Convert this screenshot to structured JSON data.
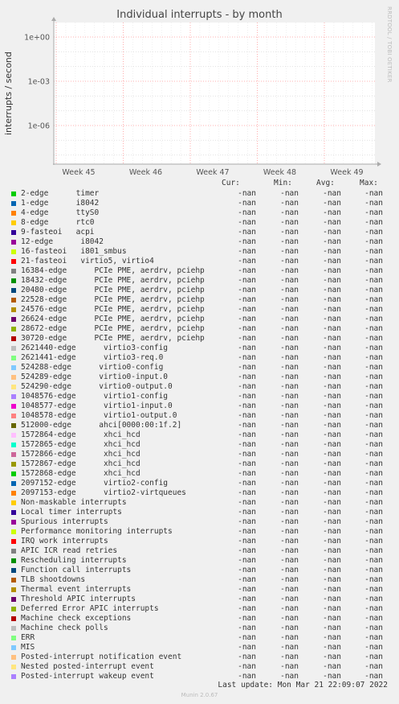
{
  "title": "Individual interrupts - by month",
  "side_label": "RRDTOOL / TOBI OETIKER",
  "footer": "Munin 2.0.67",
  "last_update": "Last update: Mon Mar 21 22:09:07 2022",
  "headers": [
    "Cur:",
    "Min:",
    "Avg:",
    "Max:"
  ],
  "chart_data": {
    "type": "line",
    "ylabel": "interrupts / second",
    "yscale": "log",
    "yticks": [
      "1e+00",
      "1e-03",
      "1e-06"
    ],
    "x": [
      "Week 45",
      "Week 46",
      "Week 47",
      "Week 48",
      "Week 49"
    ],
    "grid": true,
    "series_values": "-nan"
  },
  "legend": [
    {
      "name": "2-edge      timer",
      "color": "#00cc00"
    },
    {
      "name": "1-edge      i8042",
      "color": "#0066b3"
    },
    {
      "name": "4-edge      ttyS0",
      "color": "#ff8000"
    },
    {
      "name": "8-edge      rtc0",
      "color": "#ffcc00"
    },
    {
      "name": "9-fasteoi   acpi",
      "color": "#330099"
    },
    {
      "name": "12-edge      i8042",
      "color": "#990099"
    },
    {
      "name": "16-fasteoi   i801_smbus",
      "color": "#ccff00"
    },
    {
      "name": "21-fasteoi   virtio5, virtio4",
      "color": "#ff0000"
    },
    {
      "name": "16384-edge      PCIe PME, aerdrv, pciehp",
      "color": "#808080"
    },
    {
      "name": "18432-edge      PCIe PME, aerdrv, pciehp",
      "color": "#008f00"
    },
    {
      "name": "20480-edge      PCIe PME, aerdrv, pciehp",
      "color": "#00487d"
    },
    {
      "name": "22528-edge      PCIe PME, aerdrv, pciehp",
      "color": "#b35a00"
    },
    {
      "name": "24576-edge      PCIe PME, aerdrv, pciehp",
      "color": "#b38f00"
    },
    {
      "name": "26624-edge      PCIe PME, aerdrv, pciehp",
      "color": "#6b006b"
    },
    {
      "name": "28672-edge      PCIe PME, aerdrv, pciehp",
      "color": "#8fb300"
    },
    {
      "name": "30720-edge      PCIe PME, aerdrv, pciehp",
      "color": "#b30000"
    },
    {
      "name": "2621440-edge      virtio3-config",
      "color": "#bebebe"
    },
    {
      "name": "2621441-edge      virtio3-req.0",
      "color": "#80ff80"
    },
    {
      "name": "524288-edge      virtio0-config",
      "color": "#80c9ff"
    },
    {
      "name": "524289-edge      virtio0-input.0",
      "color": "#ffc080"
    },
    {
      "name": "524290-edge      virtio0-output.0",
      "color": "#ffe680"
    },
    {
      "name": "1048576-edge      virtio1-config",
      "color": "#aa80ff"
    },
    {
      "name": "1048577-edge      virtio1-input.0",
      "color": "#ee00cc"
    },
    {
      "name": "1048578-edge      virtio1-output.0",
      "color": "#ff8080"
    },
    {
      "name": "512000-edge      ahci[0000:00:1f.2]",
      "color": "#666600"
    },
    {
      "name": "1572864-edge      xhci_hcd",
      "color": "#ffbfff"
    },
    {
      "name": "1572865-edge      xhci_hcd",
      "color": "#00ffcc"
    },
    {
      "name": "1572866-edge      xhci_hcd",
      "color": "#cc6699"
    },
    {
      "name": "1572867-edge      xhci_hcd",
      "color": "#999900"
    },
    {
      "name": "1572868-edge      xhci_hcd",
      "color": "#00cc00"
    },
    {
      "name": "2097152-edge      virtio2-config",
      "color": "#0066b3"
    },
    {
      "name": "2097153-edge      virtio2-virtqueues",
      "color": "#ff8000"
    },
    {
      "name": "Non-maskable interrupts",
      "color": "#ffcc00"
    },
    {
      "name": "Local timer interrupts",
      "color": "#330099"
    },
    {
      "name": "Spurious interrupts",
      "color": "#990099"
    },
    {
      "name": "Performance monitoring interrupts",
      "color": "#ccff00"
    },
    {
      "name": "IRQ work interrupts",
      "color": "#ff0000"
    },
    {
      "name": "APIC ICR read retries",
      "color": "#808080"
    },
    {
      "name": "Rescheduling interrupts",
      "color": "#008f00"
    },
    {
      "name": "Function call interrupts",
      "color": "#00487d"
    },
    {
      "name": "TLB shootdowns",
      "color": "#b35a00"
    },
    {
      "name": "Thermal event interrupts",
      "color": "#b38f00"
    },
    {
      "name": "Threshold APIC interrupts",
      "color": "#6b006b"
    },
    {
      "name": "Deferred Error APIC interrupts",
      "color": "#8fb300"
    },
    {
      "name": "Machine check exceptions",
      "color": "#b30000"
    },
    {
      "name": "Machine check polls",
      "color": "#bebebe"
    },
    {
      "name": "ERR",
      "color": "#80ff80"
    },
    {
      "name": "MIS",
      "color": "#80c9ff"
    },
    {
      "name": "Posted-interrupt notification event",
      "color": "#ffc080"
    },
    {
      "name": "Nested posted-interrupt event",
      "color": "#ffe680"
    },
    {
      "name": "Posted-interrupt wakeup event",
      "color": "#aa80ff"
    }
  ]
}
